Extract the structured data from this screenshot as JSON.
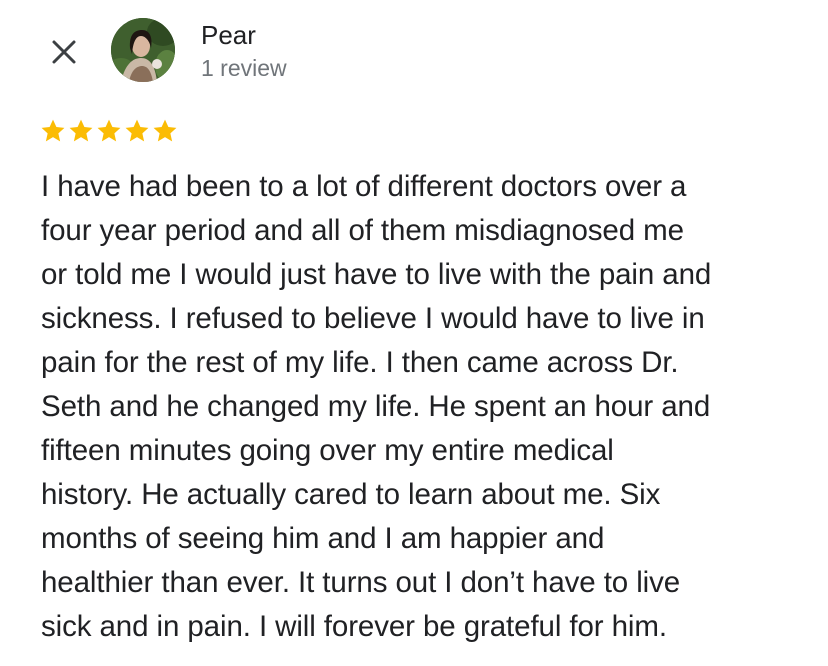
{
  "header": {
    "reviewer_name": "Pear",
    "review_count": "1 review"
  },
  "review": {
    "rating": 5,
    "max_rating": 5,
    "star_color": "#fbbc04",
    "lines": [
      "I have had been to a lot of different doctors over a",
      "four year period and all of them misdiagnosed me",
      "or told me I would just have to live with the pain and",
      "sickness. I refused to believe I would have to live in",
      "pain for the rest of my life. I then came across Dr.",
      "Seth and he changed my life. He spent an hour and",
      "fifteen minutes going over my entire medical",
      "history. He actually cared to learn about me. Six",
      "months of seeing him and I am happier and",
      "healthier than ever. It turns out I don’t have to live",
      "sick and in pain. I will forever be grateful for him."
    ]
  },
  "icons": {
    "close": "close-icon",
    "star": "star-icon",
    "avatar": "avatar"
  }
}
